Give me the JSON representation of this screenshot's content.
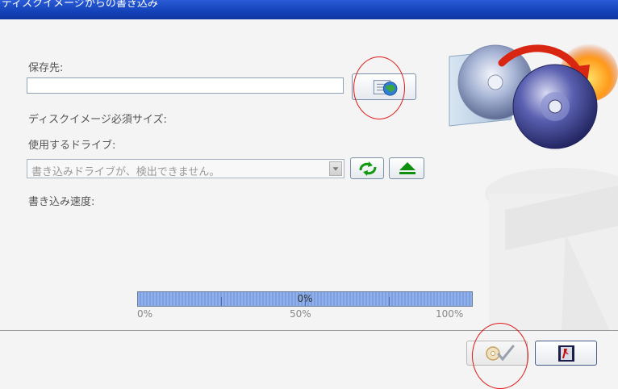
{
  "window": {
    "title": "ディスクイメージからの書き込み"
  },
  "form": {
    "save_dest_label": "保存先:",
    "save_dest_value": "",
    "required_size_label": "ディスクイメージ必須サイズ:",
    "drive_label": "使用するドライブ:",
    "drive_selected": "書き込みドライブが、検出できません。",
    "write_speed_label": "書き込み速度:"
  },
  "progress": {
    "value_percent": 0,
    "text": "0%",
    "scale": [
      "0%",
      "50%",
      "100%"
    ]
  },
  "icons": {
    "browse": "folder-globe-icon",
    "refresh": "refresh-icon",
    "eject": "eject-icon",
    "burn": "burn-disc-icon",
    "exit": "exit-icon",
    "banner": "disc-copy-icon"
  },
  "colors": {
    "title_bar": "#1342b8",
    "progress": "#7d9fdf",
    "annotation": "#e21818",
    "eject_green": "#119a11"
  }
}
